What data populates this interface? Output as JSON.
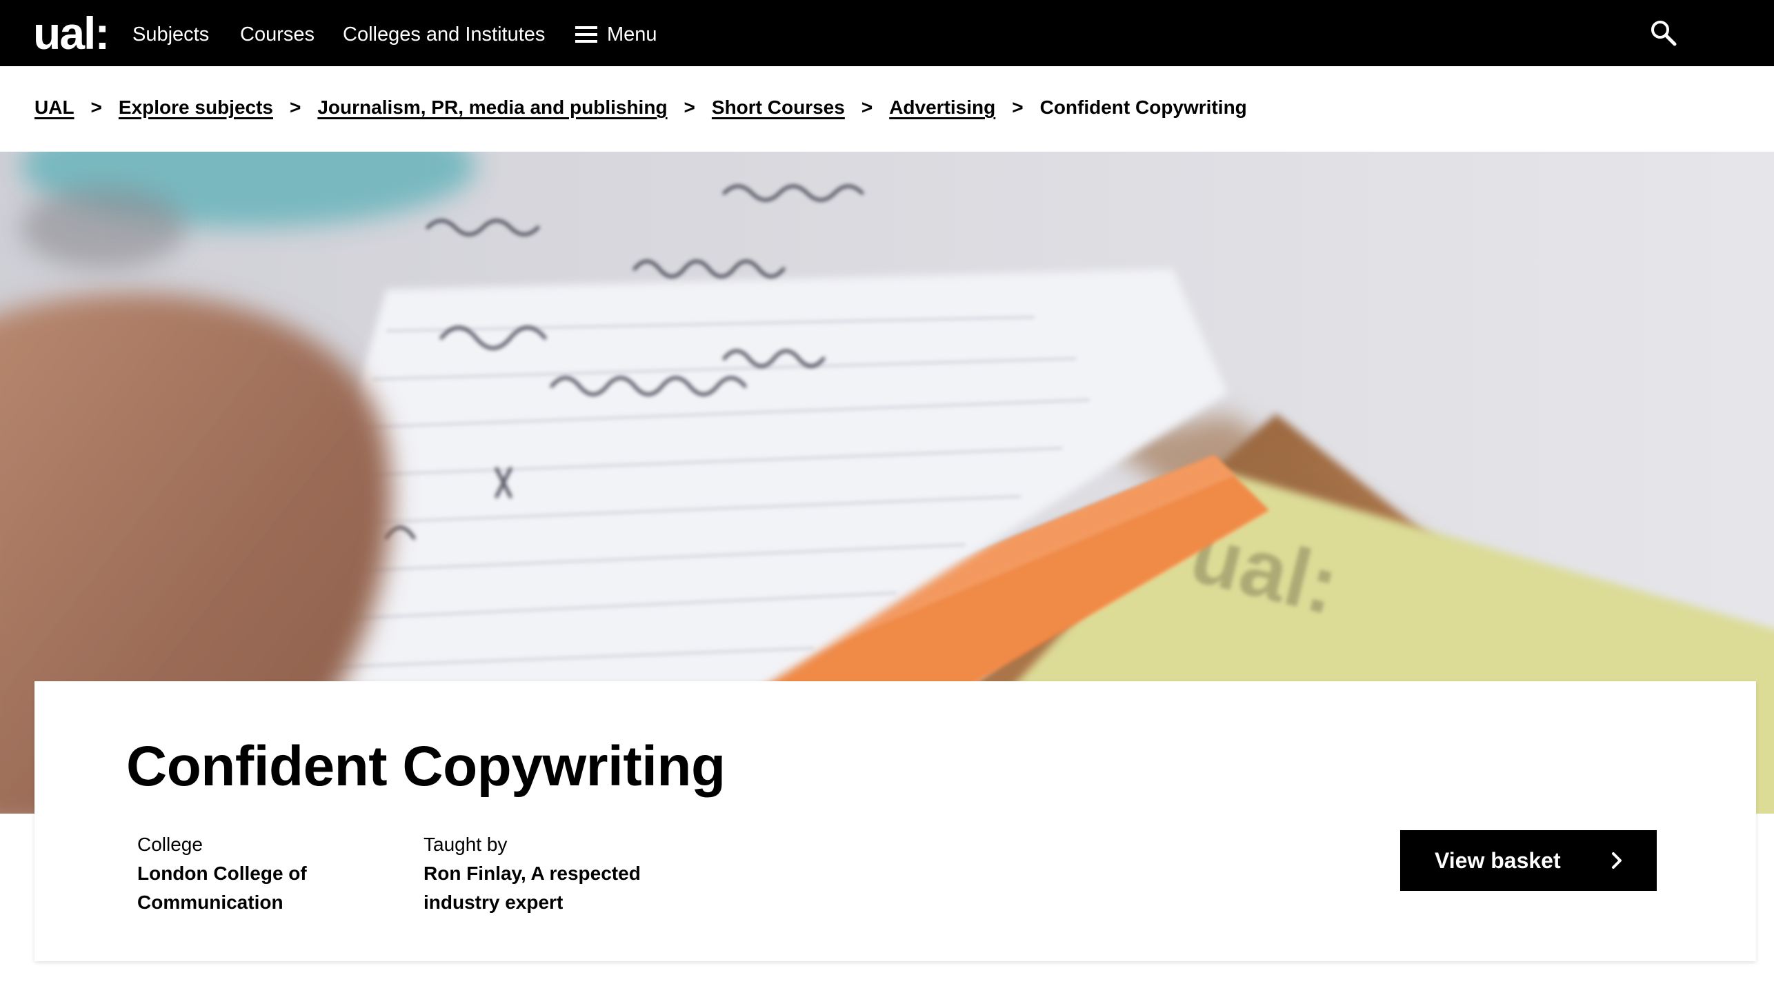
{
  "nav": {
    "logo": "ual:",
    "items": [
      {
        "label": "Subjects"
      },
      {
        "label": "Courses"
      },
      {
        "label": "Colleges and Institutes"
      }
    ],
    "menu_label": "Menu",
    "search_icon": "search-icon"
  },
  "breadcrumb": {
    "separator": ">",
    "links": [
      {
        "label": "UAL"
      },
      {
        "label": "Explore subjects"
      },
      {
        "label": "Journalism, PR, media and publishing"
      },
      {
        "label": "Short Courses"
      },
      {
        "label": "Advertising"
      }
    ],
    "current": "Confident Copywriting"
  },
  "course": {
    "title": "Confident Copywriting",
    "college_label": "College",
    "college_value": "London College of Communication",
    "taught_label": "Taught by",
    "taught_value": "Ron Finlay, A respected industry expert"
  },
  "actions": {
    "basket_label": "View basket"
  },
  "colors": {
    "nav_bg": "#000000",
    "button_bg": "#000000",
    "text": "#000000"
  }
}
